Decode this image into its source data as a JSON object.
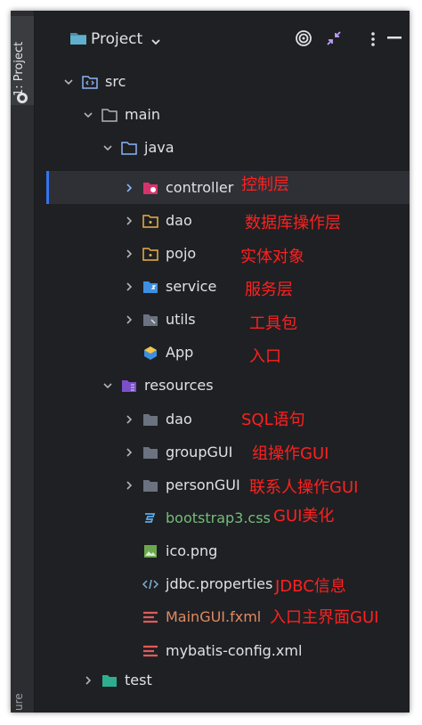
{
  "sidebar": {
    "project_tab_label": "1: Project",
    "bottom_tab_label": "ure"
  },
  "header": {
    "title": "Project"
  },
  "tree": {
    "src": "src",
    "main": "main",
    "java": "java",
    "controller": "controller",
    "dao": "dao",
    "pojo": "pojo",
    "service": "service",
    "utils": "utils",
    "app": "App",
    "resources": "resources",
    "res_dao": "dao",
    "groupgui": "groupGUI",
    "persongui": "personGUI",
    "bootstrap": "bootstrap3.css",
    "ico": "ico.png",
    "jdbc": "jdbc.properties",
    "maingui": "MainGUI.fxml",
    "mybatis": "mybatis-config.xml",
    "test": "test"
  },
  "annotations": {
    "controller": "控制层",
    "dao": "数据库操作层",
    "pojo": "实体对象",
    "service": "服务层",
    "utils": "工具包",
    "app": "入口",
    "res_dao": "SQL语句",
    "groupgui": "组操作GUI",
    "persongui": "联系人操作GUI",
    "bootstrap": "GUI美化",
    "jdbc": "JDBC信息",
    "maingui": "入口主界面GUI"
  },
  "colors": {
    "background": "#1f2023",
    "selection": "#2e3036",
    "accent": "#3574f0",
    "annotation": "#ff2020"
  },
  "icons": [
    "folder-icon",
    "chevron-down-icon",
    "target-icon",
    "collapse-icon",
    "more-icon",
    "minimize-icon",
    "source-folder-icon",
    "resources-folder-icon",
    "test-folder-icon",
    "package-icon",
    "java-class-icon",
    "css-file-icon",
    "image-file-icon",
    "properties-file-icon",
    "xml-file-icon"
  ]
}
